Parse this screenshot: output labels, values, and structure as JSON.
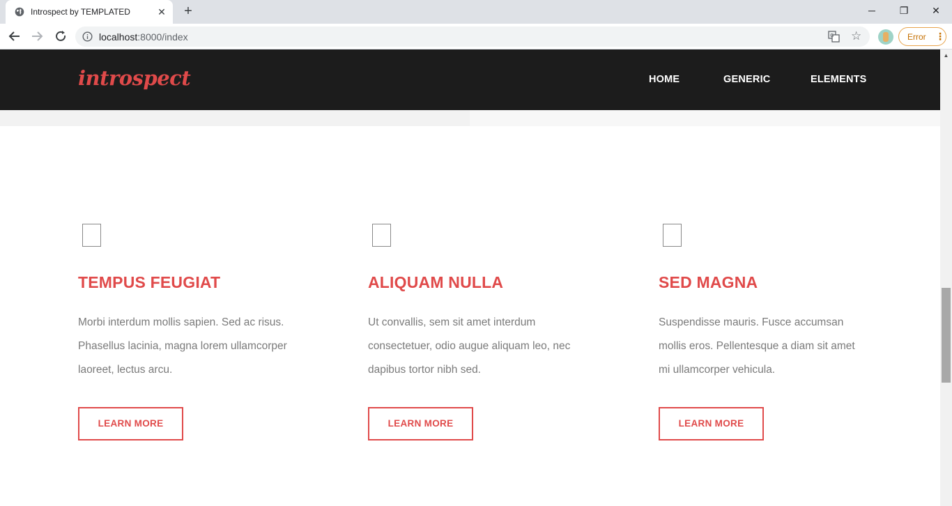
{
  "browser": {
    "tab_title": "Introspect by TEMPLATED",
    "new_tab_icon": "+",
    "close_tab_icon": "✕",
    "url_host": "localhost",
    "url_rest": ":8000/index",
    "error_label": "Error",
    "window_controls": {
      "minimize": "─",
      "maximize": "❐",
      "close": "✕"
    }
  },
  "site": {
    "logo": "introspect",
    "nav": [
      {
        "label": "HOME"
      },
      {
        "label": "GENERIC"
      },
      {
        "label": "ELEMENTS"
      }
    ]
  },
  "features": [
    {
      "title": "TEMPUS FEUGIAT",
      "text": "Morbi interdum mollis sapien. Sed ac risus. Phasellus lacinia, magna lorem ullamcorper laoreet, lectus arcu.",
      "button": "LEARN MORE"
    },
    {
      "title": "ALIQUAM NULLA",
      "text": "Ut convallis, sem sit amet interdum consectetuer, odio augue aliquam leo, nec dapibus tortor nibh sed.",
      "button": "LEARN MORE"
    },
    {
      "title": "SED MAGNA",
      "text": "Suspendisse mauris. Fusce accumsan mollis eros. Pellentesque a diam sit amet mi ullamcorper vehicula.",
      "button": "LEARN MORE"
    }
  ],
  "colors": {
    "accent": "#e04a4a",
    "header_bg": "#1c1c1c",
    "body_text": "#7a7a7a"
  }
}
